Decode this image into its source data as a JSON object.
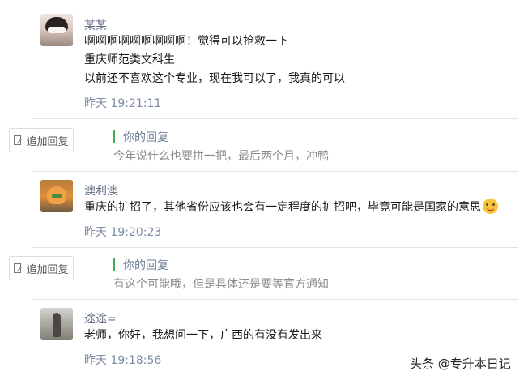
{
  "comments": [
    {
      "user": "某某",
      "lines": [
        "啊啊啊啊啊啊啊啊啊！觉得可以抢救一下",
        "重庆师范类文科生",
        "以前还不喜欢这个专业，现在我可以了，我真的可以"
      ],
      "time": "昨天 19:21:11",
      "reply_button": "追加回复",
      "reply_label": "你的回复",
      "reply_text": "今年说什么也要拼一把，最后两个月，冲鸭"
    },
    {
      "user": "澳利澳",
      "lines": [
        "重庆的扩招了，其他省份应该也会有一定程度的扩招吧，毕竟可能是国家的意思"
      ],
      "emoji": "grinning-emoji",
      "time": "昨天 19:20:23",
      "reply_button": "追加回复",
      "reply_label": "你的回复",
      "reply_text": "有这个可能哦，但是具体还是要等官方通知"
    },
    {
      "user": "途途=",
      "lines": [
        "老师，你好，我想问一下，广西的有没有发出来"
      ],
      "time": "昨天 19:18:56"
    }
  ],
  "watermark": "头条 @专升本日记",
  "colors": {
    "accent_line": "#3fb34f",
    "name": "#5f6e84",
    "time": "#7c8ba3"
  }
}
